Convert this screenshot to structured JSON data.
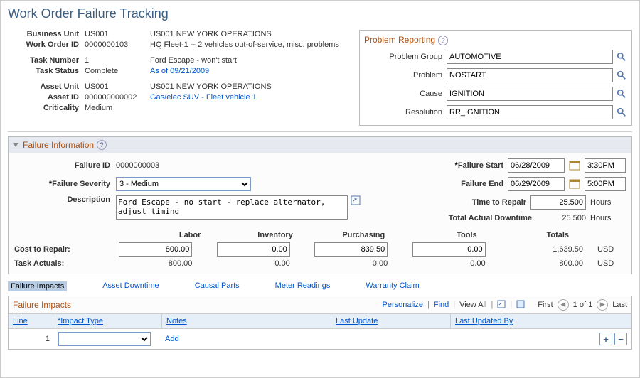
{
  "page_title": "Work Order Failure Tracking",
  "header": {
    "business_unit_lbl": "Business Unit",
    "business_unit": "US001",
    "bu_desc": "US001 NEW YORK OPERATIONS",
    "work_order_id_lbl": "Work Order ID",
    "work_order_id": "0000000103",
    "wo_desc": "HQ Fleet-1 -- 2 vehicles out-of-service, misc. problems",
    "task_number_lbl": "Task Number",
    "task_number": "1",
    "task_desc": "Ford Escape - won't start",
    "task_status_lbl": "Task Status",
    "task_status": "Complete",
    "as_of": "As of 09/21/2009",
    "asset_unit_lbl": "Asset Unit",
    "asset_unit": "US001",
    "au_desc": "US001 NEW YORK OPERATIONS",
    "asset_id_lbl": "Asset ID",
    "asset_id": "000000000002",
    "asset_link": "Gas/elec SUV - Fleet vehicle 1",
    "criticality_lbl": "Criticality",
    "criticality": "Medium"
  },
  "problem": {
    "title": "Problem Reporting",
    "group_lbl": "Problem Group",
    "group": "AUTOMOTIVE",
    "problem_lbl": "Problem",
    "problem": "NOSTART",
    "cause_lbl": "Cause",
    "cause": "IGNITION",
    "resolution_lbl": "Resolution",
    "resolution": "RR_IGNITION"
  },
  "failure": {
    "title": "Failure Information",
    "failure_id_lbl": "Failure ID",
    "failure_id": "0000000003",
    "severity_lbl": "Failure Severity",
    "severity": "3 - Medium",
    "description_lbl": "Description",
    "description": "Ford Escape - no start - replace alternator, adjust timing",
    "start_lbl": "Failure Start",
    "start_date": "06/28/2009",
    "start_time": "3:30PM",
    "end_lbl": "Failure End",
    "end_date": "06/29/2009",
    "end_time": "5:00PM",
    "ttr_lbl": "Time to Repair",
    "ttr": "25.500",
    "ttr_unit": "Hours",
    "downtime_lbl": "Total Actual Downtime",
    "downtime": "25.500",
    "downtime_unit": "Hours"
  },
  "cost": {
    "labor_lbl": "Labor",
    "inventory_lbl": "Inventory",
    "purchasing_lbl": "Purchasing",
    "tools_lbl": "Tools",
    "totals_lbl": "Totals",
    "cur": "USD",
    "row1_lbl": "Cost to Repair:",
    "row1": {
      "labor": "800.00",
      "inventory": "0.00",
      "purchasing": "839.50",
      "tools": "0.00",
      "total": "1,639.50"
    },
    "row2_lbl": "Task Actuals:",
    "row2": {
      "labor": "800.00",
      "inventory": "0.00",
      "purchasing": "0.00",
      "tools": "0.00",
      "total": "800.00"
    }
  },
  "tabs": {
    "impacts": "Failure Impacts",
    "downtime": "Asset Downtime",
    "causal": "Causal Parts",
    "meter": "Meter Readings",
    "warranty": "Warranty Claim"
  },
  "grid": {
    "title": "Failure Impacts",
    "personalize": "Personalize",
    "find": "Find",
    "viewall": "View All",
    "first": "First",
    "count": "1 of 1",
    "last": "Last",
    "cols": {
      "line": "Line",
      "impact": "*Impact Type",
      "notes": "Notes",
      "updated": "Last Update",
      "updatedby": "Last Updated By"
    },
    "row": {
      "line": "1",
      "impact": "",
      "notes": "Add"
    }
  }
}
